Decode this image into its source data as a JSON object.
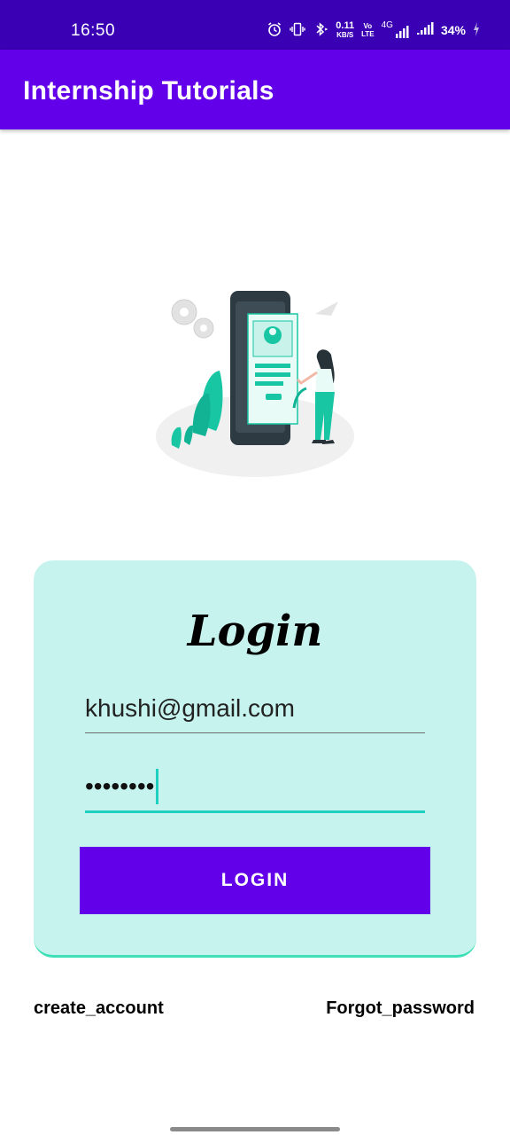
{
  "status_bar": {
    "time": "16:50",
    "net_speed_value": "0.11",
    "net_speed_unit": "KB/S",
    "volte_top": "Vo",
    "volte_bottom": "LTE",
    "volte2_top": "Vo",
    "volte2_bottom": "LTE",
    "network": "4G",
    "battery": "34%",
    "icons": [
      "alarm-icon",
      "vibrate-icon",
      "bluetooth-icon",
      "signal-icon",
      "signal-icon",
      "battery-charging-icon"
    ]
  },
  "app_bar": {
    "title": "Internship Tutorials"
  },
  "login_card": {
    "title": "Login",
    "email_value": "khushi@gmail.com",
    "password_value": "••••••••",
    "button_label": "LOGIN"
  },
  "links": {
    "create_account": "create_account",
    "forgot_password": "Forgot_password"
  },
  "colors": {
    "status_bar": "#3a00b3",
    "primary": "#6200ea",
    "card_bg": "#c6f3ee",
    "accent": "#1fcfc0"
  }
}
